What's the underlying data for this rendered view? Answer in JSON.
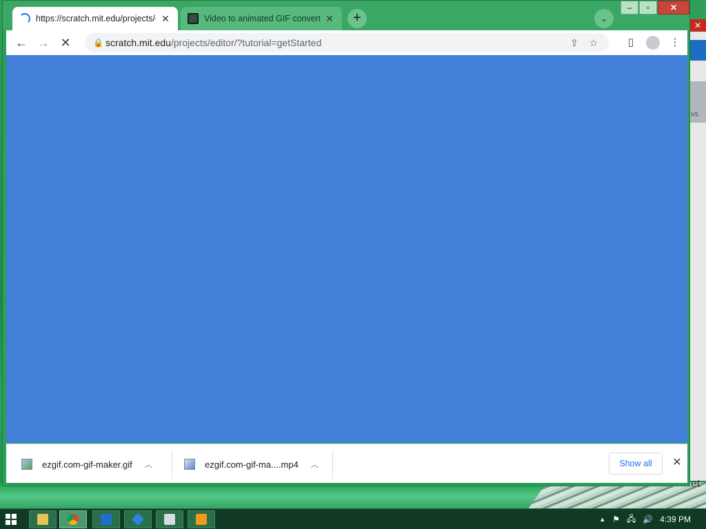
{
  "browser": {
    "tabs": [
      {
        "title": "https://scratch.mit.edu/projects/e",
        "state": "loading"
      },
      {
        "title": "Video to animated GIF converter"
      }
    ],
    "new_tab_symbol": "+",
    "tab_search_symbol": "⌄",
    "window_buttons": {
      "minimize": "–",
      "maximize": "▫",
      "close": "✕"
    },
    "toolbar": {
      "back_symbol": "←",
      "forward_symbol": "→",
      "stop_symbol": "✕",
      "url_host": "scratch.mit.edu",
      "url_path": "/projects/editor/?tutorial=getStarted",
      "share_symbol": "⇪",
      "bookmark_symbol": "☆",
      "sidepanel_symbol": "▯",
      "menu_symbol": "⋮"
    },
    "page_background": "#427fd8"
  },
  "downloads": {
    "items": [
      {
        "name": "ezgif.com-gif-maker.gif",
        "icon": "image-file-icon"
      },
      {
        "name": "ezgif.com-gif-ma....mp4",
        "icon": "video-file-icon"
      }
    ],
    "chevron_symbol": "︿",
    "show_all_label": "Show all",
    "close_symbol": "✕"
  },
  "background_window": {
    "close_symbol": "✕",
    "text1": "vs",
    "text2": "et"
  },
  "taskbar": {
    "apps": [
      "file-explorer-icon",
      "chrome-icon",
      "app-blue-icon",
      "app-blue2-icon",
      "app-gray-icon",
      "media-player-icon"
    ],
    "tray": {
      "up_arrow": "▲",
      "flag_symbol": "⚑",
      "network_symbol": "🖧",
      "volume_symbol": "🔊"
    },
    "clock": "4:39 PM"
  }
}
